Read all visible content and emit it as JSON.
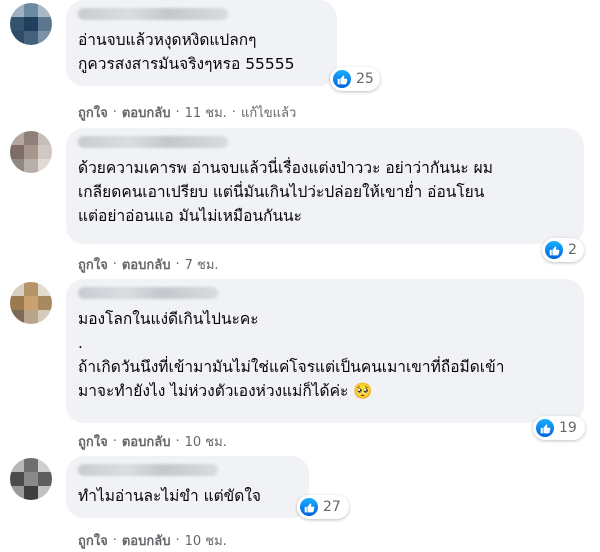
{
  "comments": [
    {
      "text": "อ่านจบแล้วหงุดหงิดแปลกๆ\nกูควรสงสารมันจริงๆหรอ 55555",
      "reactions": "25",
      "like": "ถูกใจ",
      "reply": "ตอบกลับ",
      "time": "11 ชม.",
      "edited": "แก้ไขแล้ว"
    },
    {
      "text": "ด้วยความเคารพ อ่านจบแล้วนี่เรื่องแต่งป่าววะ อย่าว่ากันนะ ผม\nเกลียดคนเอาเปรียบ แต่นี่มันเกินไปว่ะปล่อยให้เขาย่ำ อ่อนโยน\nแต่อย่าอ่อนแอ มันไม่เหมือนกันนะ",
      "reactions": "2",
      "like": "ถูกใจ",
      "reply": "ตอบกลับ",
      "time": "7 ชม."
    },
    {
      "text": "มองโลกในแง่ดีเกินไปนะคะ\n.\nถ้าเกิดวันนึงที่เข้ามามันไม่ใช่แค่โจรแต่เป็นคนเมาเขาที่ถือมีดเข้า\nมาจะทำยังไง ไม่ห่วงตัวเองห่วงแม่ก็ได้ค่ะ 🥺",
      "reactions": "19",
      "like": "ถูกใจ",
      "reply": "ตอบกลับ",
      "time": "10 ชม."
    },
    {
      "text": "ทำไมอ่านละไม่ขำ แต่ขัดใจ",
      "reactions": "27",
      "like": "ถูกใจ",
      "reply": "ตอบกลับ",
      "time": "10 ชม."
    }
  ],
  "colors": {
    "bubble": "#f0f2f5",
    "meta": "#65676b",
    "like_blue": "#0866ff"
  },
  "icons": {
    "reaction": "thumbs-up-icon"
  }
}
